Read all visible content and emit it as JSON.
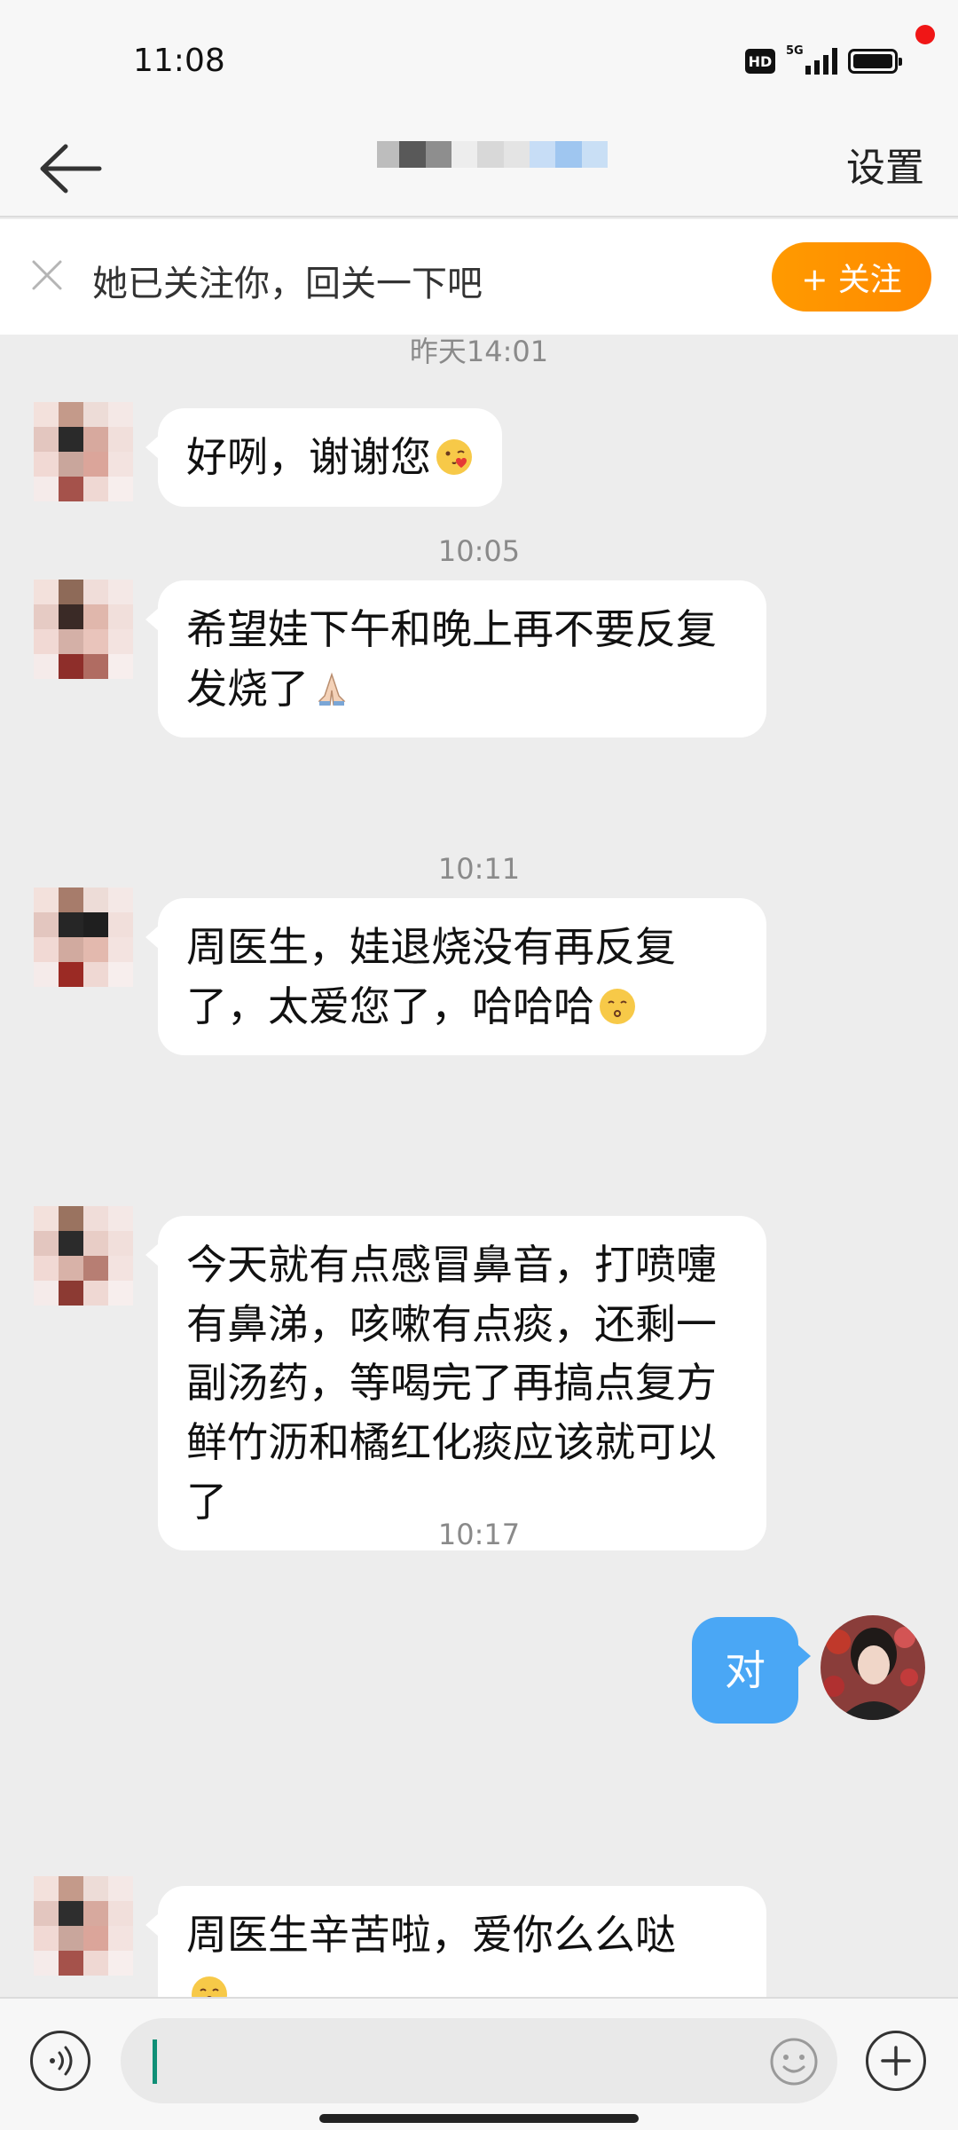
{
  "status_bar": {
    "time": "11:08",
    "hd": "HD",
    "network": "5G"
  },
  "nav": {
    "settings_label": "设置"
  },
  "follow_bar": {
    "text": "她已关注你，回关一下吧",
    "button": "+ 关注"
  },
  "messages": [
    {
      "type": "timestamp",
      "text": "昨天14:01"
    },
    {
      "type": "received",
      "text": "好咧，谢谢您",
      "emoji": "face-blowing-kiss"
    },
    {
      "type": "received",
      "text": "希望娃下午和晚上再不要反复发烧了",
      "emoji": "folded-hands"
    },
    {
      "type": "timestamp",
      "text": "10:05"
    },
    {
      "type": "received",
      "text": "周医生，娃退烧没有再反复了，太爱您了，哈哈哈",
      "emoji": "kissing-face"
    },
    {
      "type": "timestamp",
      "text": "10:11"
    },
    {
      "type": "received",
      "text": "今天就有点感冒鼻音，打喷嚏有鼻涕，咳嗽有点痰，还剩一副汤药，等喝完了再搞点复方鲜竹沥和橘红化痰应该就可以了"
    },
    {
      "type": "sent",
      "text": "对"
    },
    {
      "type": "timestamp",
      "text": "10:17"
    },
    {
      "type": "received",
      "text": "周医生辛苦啦，爱你么么哒",
      "emoji": "kiss-heart"
    }
  ],
  "colors": {
    "accent_orange": "#ff9a00",
    "sent_bubble": "#4aa7f5",
    "background": "#ededed"
  },
  "icons": [
    "back-arrow-icon",
    "close-icon",
    "voice-icon",
    "emoji-icon",
    "plus-icon"
  ]
}
